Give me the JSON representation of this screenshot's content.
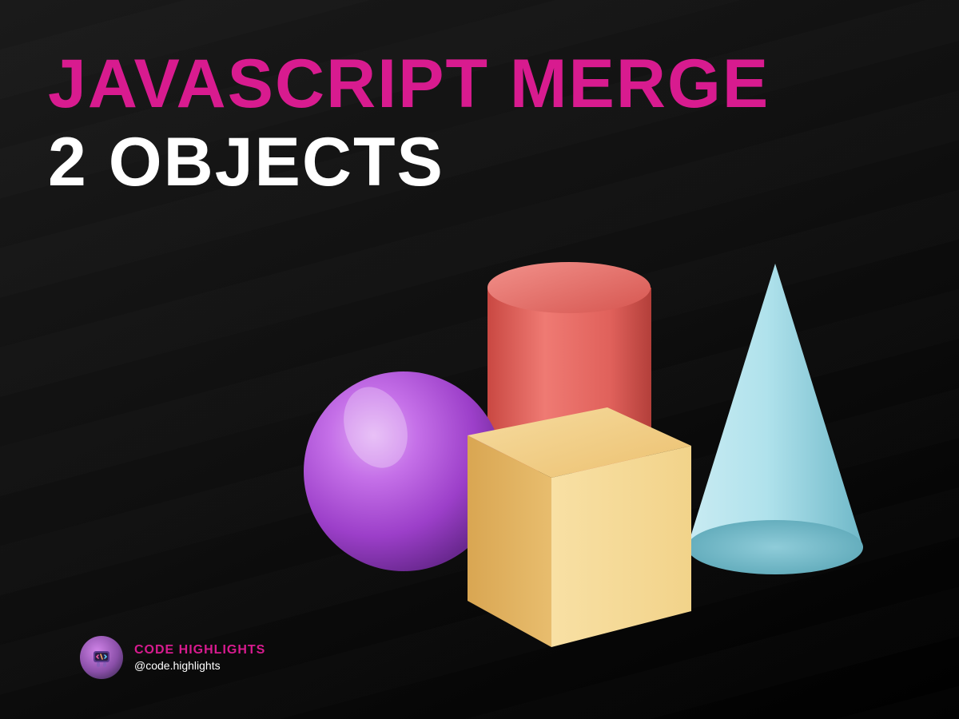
{
  "title": {
    "line1": "JAVASCRIPT MERGE",
    "line2": "2 OBJECTS"
  },
  "colors": {
    "accent": "#d81b8f",
    "text_white": "#ffffff",
    "bg_dark": "#0a0a0a",
    "shape_sphere": "#b157d8",
    "shape_cylinder": "#e8625f",
    "shape_cube": "#f4ce7a",
    "shape_cone": "#a7dde8"
  },
  "shapes": [
    {
      "name": "sphere",
      "color": "purple"
    },
    {
      "name": "cylinder",
      "color": "red"
    },
    {
      "name": "cube",
      "color": "yellow"
    },
    {
      "name": "cone",
      "color": "light-blue"
    }
  ],
  "footer": {
    "brand": "CODE HIGHLIGHTS",
    "handle": "@code.highlights",
    "avatar_icon": "code-character-icon"
  }
}
